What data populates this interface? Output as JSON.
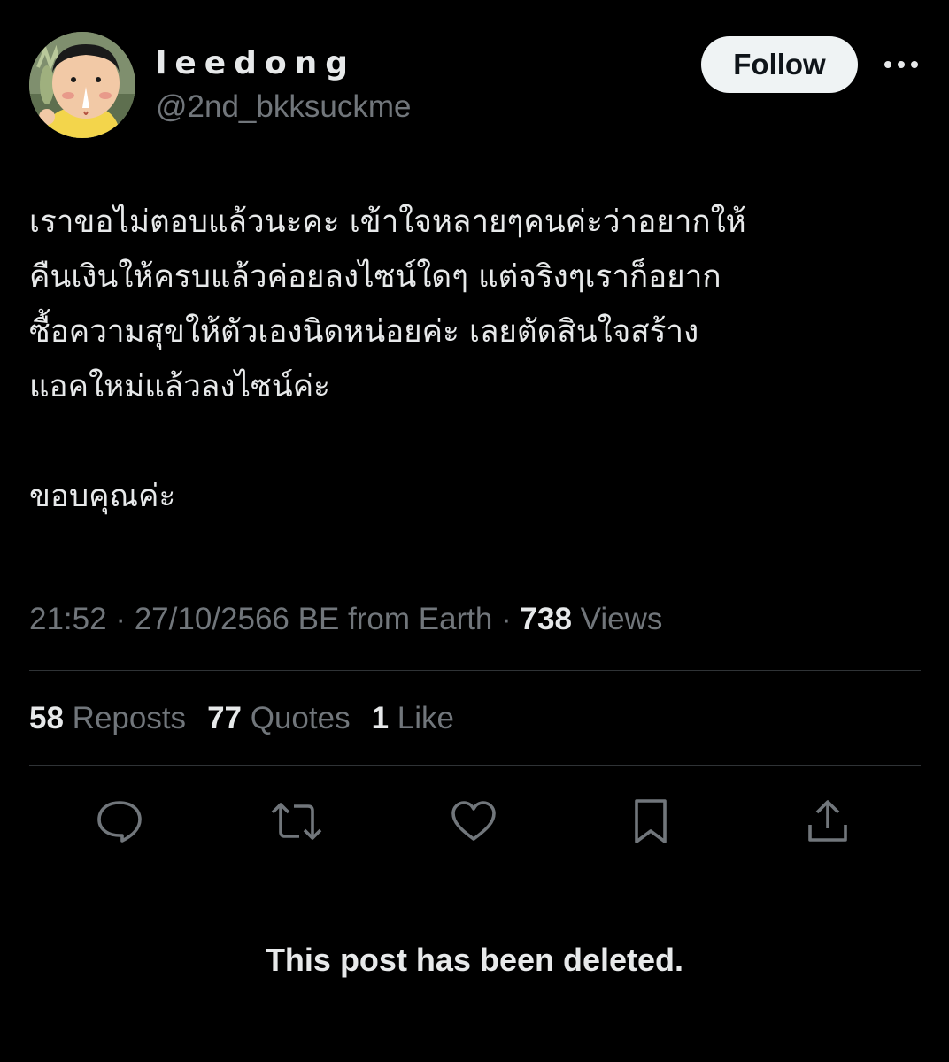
{
  "user": {
    "display_name": "leedong",
    "handle": "@2nd_bkksuckme",
    "avatar_icon": "cartoon-boy-avatar"
  },
  "header": {
    "follow_label": "Follow",
    "more_icon": "more-horizontal-icon"
  },
  "tweet": {
    "text": "เราขอไม่ตอบแล้วนะคะ เข้าใจหลายๆคนค่ะว่าอยากให้\nคืนเงินให้ครบแล้วค่อยลงไซน์ใดๆ แต่จริงๆเราก็อยาก\nซื้อความสุขให้ตัวเองนิดหน่อยค่ะ เลยตัดสินใจสร้าง\nแอคใหม่แล้วลงไซน์ค่ะ\n\nขอบคุณค่ะ"
  },
  "meta": {
    "time": "21:52",
    "separator": " · ",
    "date": "27/10/2566 BE",
    "source": " from Earth",
    "views_count": "738",
    "views_label": " Views"
  },
  "stats": {
    "reposts_count": "58",
    "reposts_label": " Reposts",
    "quotes_count": "77",
    "quotes_label": " Quotes",
    "likes_count": "1",
    "likes_label": " Like"
  },
  "actions": {
    "reply_icon": "reply-icon",
    "repost_icon": "repost-icon",
    "like_icon": "like-icon",
    "bookmark_icon": "bookmark-icon",
    "share_icon": "share-icon"
  },
  "notice": {
    "deleted_text": "This post has been deleted."
  },
  "colors": {
    "background": "#000000",
    "text_primary": "#e7e9ea",
    "text_secondary": "#71767b",
    "divider": "#2f3336",
    "follow_bg": "#eff3f4"
  }
}
